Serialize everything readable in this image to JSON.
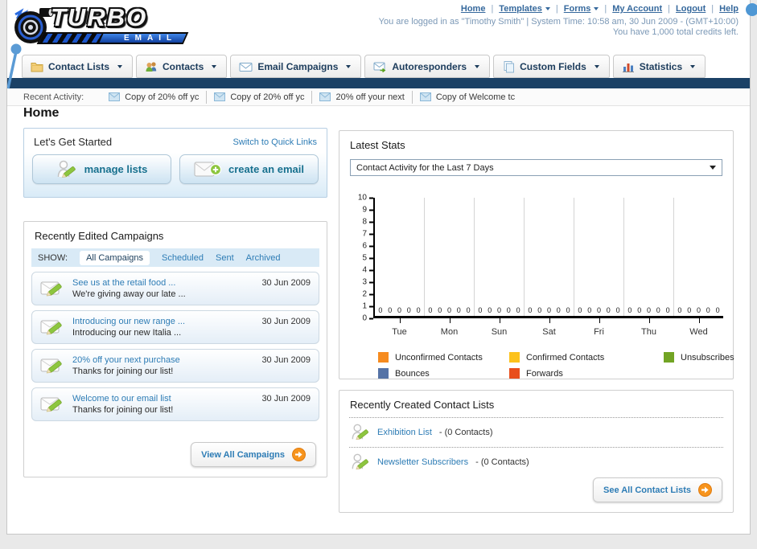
{
  "brand": {
    "name_top": "TURBO",
    "name_bottom": "EMAIL"
  },
  "colors": {
    "navy_bar": "#1b4166",
    "link_blue": "#2d7cb5",
    "button_teal": "#17708e",
    "accent_orange": "#f7941d",
    "pencil_green": "#8dc63f"
  },
  "header": {
    "links": [
      {
        "label": "Home",
        "dropdown": false
      },
      {
        "label": "Templates",
        "dropdown": true
      },
      {
        "label": "Forms",
        "dropdown": true
      },
      {
        "label": "My Account",
        "dropdown": false
      },
      {
        "label": "Logout",
        "dropdown": false
      },
      {
        "label": "Help",
        "dropdown": false
      }
    ],
    "login_status": "You are logged in as \"Timothy Smith\" | System Time: 10:58 am, 30 Jun 2009 - (GMT+10:00)",
    "credits": "You have 1,000 total credits left."
  },
  "nav": {
    "tabs": [
      {
        "label": "Contact Lists",
        "icon": "folder-icon"
      },
      {
        "label": "Contacts",
        "icon": "people-icon"
      },
      {
        "label": "Email Campaigns",
        "icon": "envelope-icon"
      },
      {
        "label": "Autoresponders",
        "icon": "envelope-arrow-icon"
      },
      {
        "label": "Custom Fields",
        "icon": "pages-icon"
      },
      {
        "label": "Statistics",
        "icon": "bar-chart-icon"
      }
    ]
  },
  "recent_activity": {
    "label": "Recent Activity:",
    "items": [
      "Copy of 20% off yc",
      "Copy of 20% off yc",
      "20% off your next",
      "Copy of Welcome tc"
    ]
  },
  "page_title": "Home",
  "get_started": {
    "title": "Let's Get Started",
    "switch_link": "Switch to Quick Links",
    "buttons": [
      {
        "label": "manage lists"
      },
      {
        "label": "create an email"
      }
    ]
  },
  "campaigns": {
    "title": "Recently Edited Campaigns",
    "show_label": "SHOW:",
    "filters": [
      "All Campaigns",
      "Scheduled",
      "Sent",
      "Archived"
    ],
    "active_filter": "All Campaigns",
    "items": [
      {
        "title": "See us at the retail food ...",
        "subtitle": "We're giving away our late ...",
        "date": "30 Jun 2009"
      },
      {
        "title": "Introducing our new range ...",
        "subtitle": "Introducing our new Italia ...",
        "date": "30 Jun 2009"
      },
      {
        "title": "20% off your next purchase",
        "subtitle": "Thanks for joining our list!",
        "date": "30 Jun 2009"
      },
      {
        "title": "Welcome to our email list",
        "subtitle": "Thanks for joining our list!",
        "date": "30 Jun 2009"
      }
    ],
    "view_all_label": "View All Campaigns"
  },
  "stats": {
    "title": "Latest Stats",
    "dropdown_value": "Contact Activity for the Last 7 Days"
  },
  "chart_data": {
    "type": "bar",
    "title": "Contact Activity for the Last 7 Days",
    "categories": [
      "Tue",
      "Mon",
      "Sun",
      "Sat",
      "Fri",
      "Thu",
      "Wed"
    ],
    "series": [
      {
        "name": "Unconfirmed Contacts",
        "color": "#f68b1f",
        "values": [
          0,
          0,
          0,
          0,
          0,
          0,
          0
        ]
      },
      {
        "name": "Confirmed Contacts",
        "color": "#fcc21c",
        "values": [
          0,
          0,
          0,
          0,
          0,
          0,
          0
        ]
      },
      {
        "name": "Unsubscribes",
        "color": "#72a424",
        "values": [
          0,
          0,
          0,
          0,
          0,
          0,
          0
        ]
      },
      {
        "name": "Bounces",
        "color": "#5573a6",
        "values": [
          0,
          0,
          0,
          0,
          0,
          0,
          0
        ]
      },
      {
        "name": "Forwards",
        "color": "#e84e1c",
        "values": [
          0,
          0,
          0,
          0,
          0,
          0,
          0
        ]
      }
    ],
    "ylim": [
      0,
      10
    ],
    "ytick_step": 1,
    "grid": "vertical",
    "legend_position": "bottom"
  },
  "contact_lists": {
    "title": "Recently Created Contact Lists",
    "items": [
      {
        "name": "Exhibition List",
        "detail": "- (0 Contacts)"
      },
      {
        "name": "Newsletter Subscribers",
        "detail": "- (0 Contacts)"
      }
    ],
    "see_all_label": "See All Contact Lists"
  }
}
